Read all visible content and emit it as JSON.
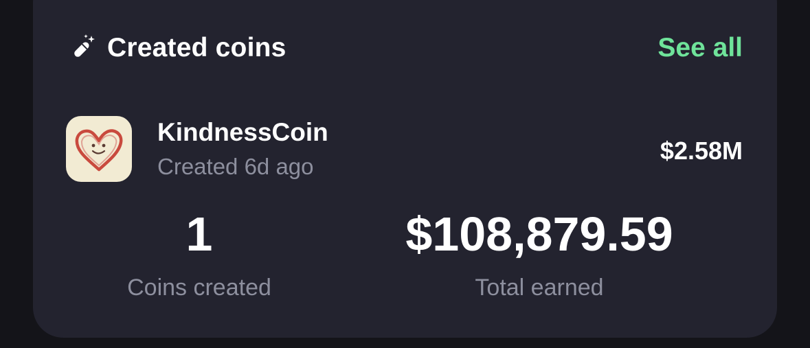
{
  "card": {
    "icon": "magic-wand-icon",
    "title": "Created coins",
    "see_all_label": "See all"
  },
  "coins": [
    {
      "icon": "heart-smiley-icon",
      "name": "KindnessCoin",
      "created": "Created 6d ago",
      "value": "$2.58M"
    }
  ],
  "stats": {
    "coins_created_value": "1",
    "coins_created_label": "Coins created",
    "total_earned_value": "$108,879.59",
    "total_earned_label": "Total earned"
  },
  "colors": {
    "background": "#141419",
    "card": "#23232f",
    "accent": "#6fe39a",
    "secondary_text": "#8d8f9e",
    "avatar_bg": "#f2ebd3",
    "heart": "#c94a3e"
  }
}
